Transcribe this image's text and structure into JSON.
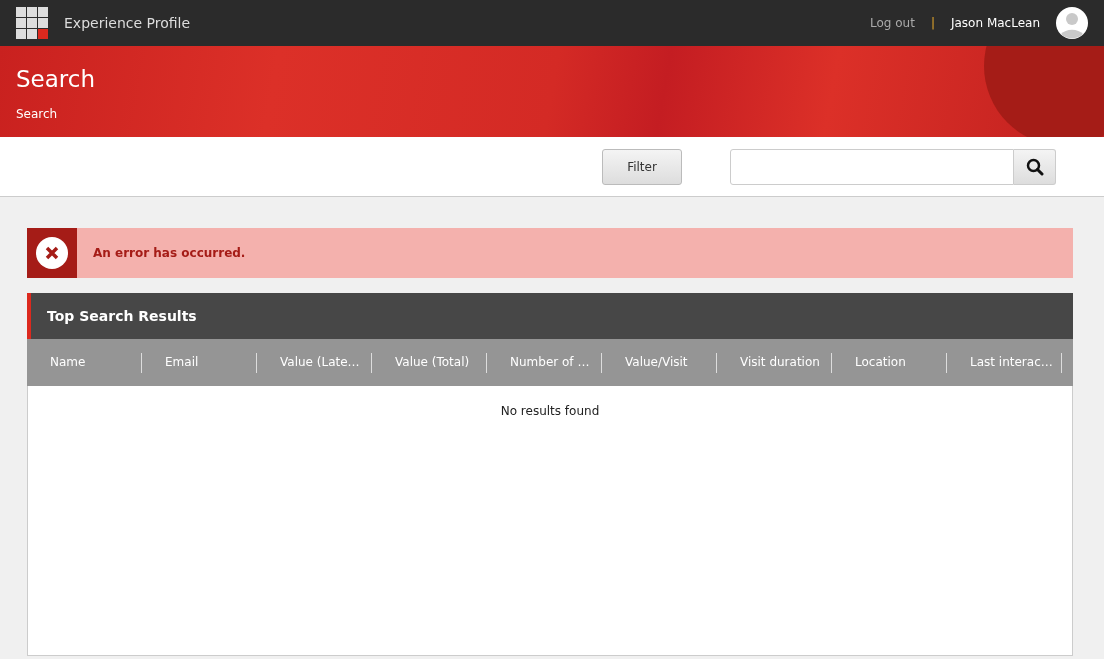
{
  "topbar": {
    "app_title": "Experience Profile",
    "logout": "Log out",
    "separator": "|",
    "user_name": "Jason MacLean"
  },
  "banner": {
    "title": "Search",
    "breadcrumb": "Search"
  },
  "toolbar": {
    "filter_button": "Filter"
  },
  "error": {
    "message": "An error has occurred."
  },
  "results": {
    "title": "Top Search Results",
    "columns": [
      "Name",
      "Email",
      "Value (Late…",
      "Value (Total)",
      "Number of …",
      "Value/Visit",
      "Visit duration",
      "Location",
      "Last interac…"
    ],
    "empty_message": "No results found"
  }
}
